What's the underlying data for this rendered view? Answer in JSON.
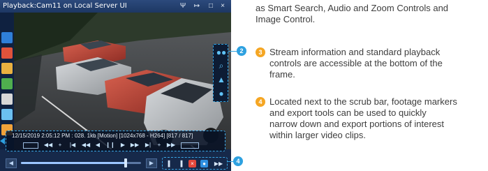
{
  "player": {
    "title": "Playback:Cam11 on Local Server UI",
    "window_buttons": [
      "Ψ",
      "↦",
      "□",
      "×"
    ],
    "left_toolbar": [
      {
        "icon": "camera-select-icon",
        "color": "#2f7fd8"
      },
      {
        "icon": "stop-record-icon",
        "color": "#e0533b"
      },
      {
        "icon": "folder-icon",
        "color": "#e9b040"
      },
      {
        "icon": "image-snapshot-icon",
        "color": "#4fae4e"
      },
      {
        "icon": "print-icon",
        "color": "#d7d7d7"
      },
      {
        "icon": "copy-icon",
        "color": "#6bc0f0"
      },
      {
        "icon": "tag-icon",
        "color": "#f0a23a"
      }
    ],
    "right_tools": [
      {
        "icon": "binoculars-icon",
        "glyph": "●●"
      },
      {
        "icon": "search-icon",
        "glyph": "⌕"
      },
      {
        "icon": "image-icon",
        "glyph": "▲"
      },
      {
        "icon": "microphone-icon",
        "glyph": "●"
      }
    ],
    "info_text": "12/15/2019 2:05:12 PM : 028. 1kb [Motion] [1024x768 - H264] [817 / 817]",
    "playback_controls": [
      {
        "name": "rewind-fast",
        "glyph": "◀◀"
      },
      {
        "name": "step-plus",
        "glyph": "+"
      },
      {
        "name": "skip-start",
        "glyph": "|◀"
      },
      {
        "name": "rewind",
        "glyph": "◀◀"
      },
      {
        "name": "step-back",
        "glyph": "◀"
      },
      {
        "name": "pause",
        "glyph": "❙❙"
      },
      {
        "name": "play",
        "glyph": "▶"
      },
      {
        "name": "forward",
        "glyph": "▶▶"
      },
      {
        "name": "skip-end",
        "glyph": "▶|"
      },
      {
        "name": "step-plus-right",
        "glyph": "+"
      },
      {
        "name": "fast-forward",
        "glyph": "▶▶"
      }
    ],
    "scrub": {
      "progress": 0.87,
      "prev_glyph": "◀",
      "next_glyph": "▶"
    },
    "export_tools": [
      {
        "icon": "mark-in-icon",
        "glyph": "▌",
        "color": "#d8e7f8"
      },
      {
        "icon": "mark-out-icon",
        "glyph": "▐",
        "color": "#d8e7f8"
      },
      {
        "icon": "clear-markers-icon",
        "glyph": "×",
        "color": "#e2473b"
      },
      {
        "icon": "export-icon",
        "glyph": "●",
        "color": "#2f8fe0"
      },
      {
        "icon": "fast-export-icon",
        "glyph": "▶▶",
        "color": "#d8e7f8"
      }
    ]
  },
  "callouts": [
    "2",
    "4"
  ],
  "description": {
    "intro_lines": "as Smart Search, Audio and Zoom Controls and\nImage Control.",
    "items": [
      {
        "number": "3",
        "text": "Stream information and standard playback\ncontrols are accessible at the bottom of the\nframe."
      },
      {
        "number": "4",
        "text": "Located next to the scrub bar, footage markers\nand export tools can be used to quickly\nnarrow down and export portions of interest\nwithin larger video clips."
      }
    ]
  },
  "colors": {
    "accent": "#2ea1e0",
    "number_badge": "#f5a623",
    "frame": "#16294a",
    "text": "#3d3d3d"
  }
}
